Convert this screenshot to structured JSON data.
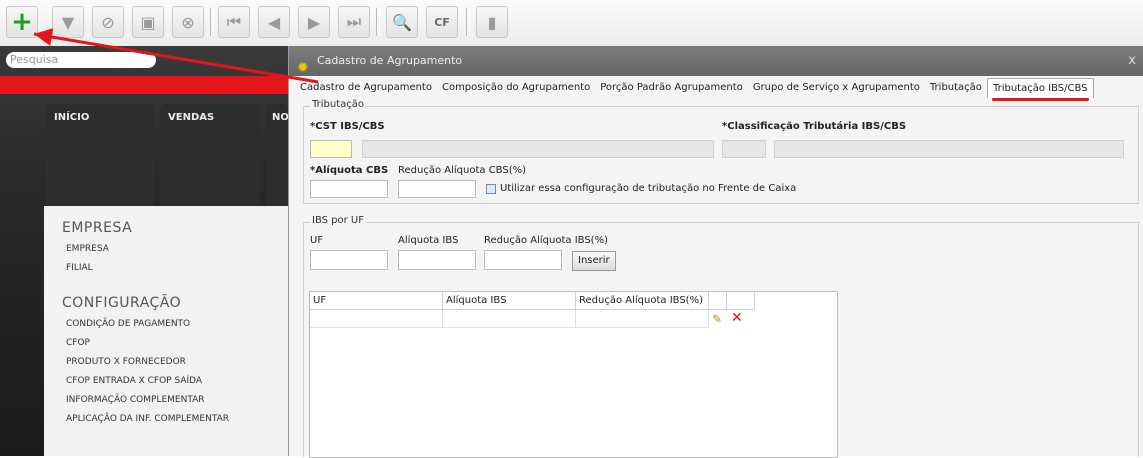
{
  "toolbar": {
    "buttons": [
      "add-icon",
      "filter-icon",
      "cancel-icon",
      "save-icon",
      "delete-icon",
      "first-icon",
      "prev-icon",
      "next-icon",
      "last-icon",
      "search-icon",
      "cfop-icon",
      "print-icon"
    ]
  },
  "left": {
    "search_placeholder": "Pesquisa",
    "tiles": [
      "INÍCIO",
      "VENDAS",
      "NO"
    ],
    "sections": [
      {
        "title": "EMPRESA",
        "items": [
          "EMPRESA",
          "FILIAL"
        ]
      },
      {
        "title": "CONFIGURAÇÃO",
        "items": [
          "CONDIÇÃO DE PAGAMENTO",
          "CFOP",
          "PRODUTO X FORNECEDOR",
          "CFOP ENTRADA X CFOP SAÍDA",
          "INFORMAÇÃO COMPLEMENTAR",
          "APLICAÇÃO DA INF. COMPLEMENTAR"
        ]
      }
    ]
  },
  "dialog": {
    "title": "Cadastro de Agrupamento",
    "close": "x",
    "tabs": [
      "Cadastro de Agrupamento",
      "Composição do Agrupamento",
      "Porção Padrão Agrupamento",
      "Grupo de Serviço x Agrupamento",
      "Tributação",
      "Tributação IBS/CBS"
    ],
    "active_tab": 5,
    "tributacao": {
      "legend": "Tributação",
      "cst_label": "*CST IBS/CBS",
      "class_label": "*Classificação Tributária IBS/CBS",
      "aliq_cbs_label": "*Alíquota CBS",
      "red_cbs_label": "Redução Alíquota CBS(%)",
      "check_label": "Utilizar essa configuração de tributação no Frente de Caixa"
    },
    "ibs": {
      "legend": "IBS por UF",
      "uf_label": "UF",
      "aliq_label": "Alíquota IBS",
      "red_label": "Redução Alíquota IBS(%)",
      "insert_button": "Inserir",
      "grid_headers": [
        "UF",
        "Alíquota IBS",
        "Redução Alíquota IBS(%)"
      ]
    }
  }
}
